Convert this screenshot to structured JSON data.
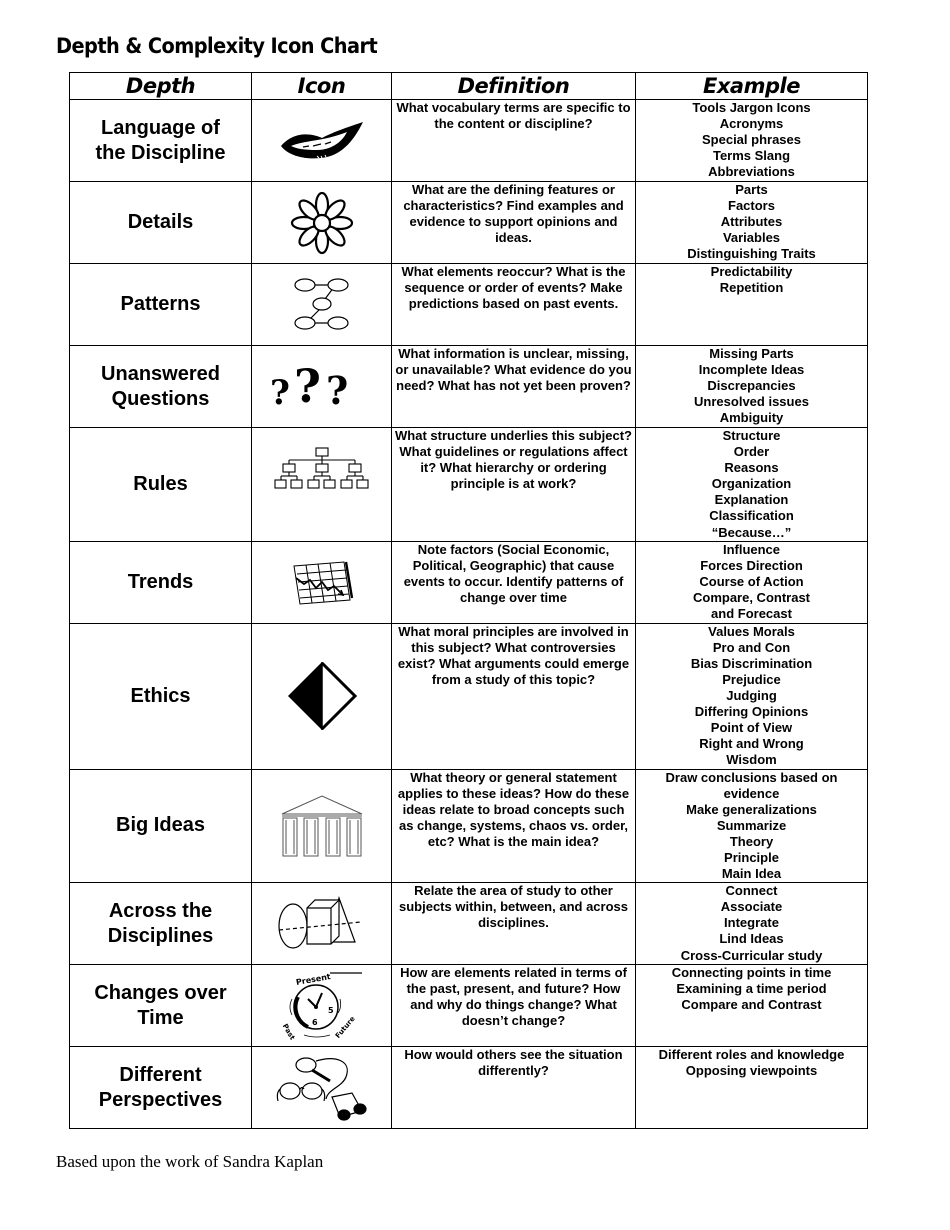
{
  "title": "Depth & Complexity Icon Chart",
  "headers": {
    "depth": "Depth",
    "icon": "Icon",
    "definition": "Definition",
    "example": "Example"
  },
  "rows": [
    {
      "depth": "Language of the Discipline",
      "icon": "lips-icon",
      "definition": "What vocabulary terms are specific to the content or discipline?",
      "examples": [
        "Tools Jargon Icons",
        "Acronyms",
        "Special phrases",
        "Terms Slang",
        "Abbreviations"
      ]
    },
    {
      "depth": "Details",
      "icon": "flower-icon",
      "definition": "What are the defining features or characteristics? Find examples and evidence to support opinions and ideas.",
      "examples": [
        "Parts",
        "Factors",
        "Attributes",
        "Variables",
        "Distinguishing Traits"
      ]
    },
    {
      "depth": "Patterns",
      "icon": "connected-circles-icon",
      "definition": "What elements reoccur? What is the sequence or order of events? Make predictions based on past events.",
      "examples": [
        "Predictability",
        "Repetition"
      ]
    },
    {
      "depth": "Unanswered Questions",
      "icon": "question-marks-icon",
      "definition": "What information is unclear, missing, or unavailable? What evidence do you need? What has not yet been proven?",
      "examples": [
        "Missing Parts",
        "Incomplete Ideas",
        "Discrepancies",
        "Unresolved issues",
        "Ambiguity"
      ]
    },
    {
      "depth": "Rules",
      "icon": "hierarchy-icon",
      "definition": "What structure underlies this subject? What guidelines or regulations affect it? What hierarchy or ordering principle is at work?",
      "examples": [
        "Structure",
        "Order",
        "Reasons",
        "Organization",
        "Explanation",
        "Classification",
        "“Because…”"
      ]
    },
    {
      "depth": "Trends",
      "icon": "trend-graph-icon",
      "definition": "Note factors (Social Economic, Political, Geographic) that cause events to occur. Identify patterns of change over time",
      "examples": [
        "Influence",
        "Forces Direction",
        "Course of Action",
        "Compare, Contrast",
        "and Forecast"
      ]
    },
    {
      "depth": "Ethics",
      "icon": "half-diamond-icon",
      "definition": "What moral principles are involved in this subject? What controversies exist? What arguments could emerge from a study of this topic?",
      "examples": [
        "Values Morals",
        "Pro and Con",
        "Bias Discrimination",
        "Prejudice",
        "Judging",
        "Differing Opinions",
        "Point of View",
        "Right and Wrong",
        "Wisdom"
      ]
    },
    {
      "depth": "Big Ideas",
      "icon": "temple-icon",
      "definition": "What theory or general statement applies to these ideas? How do these ideas relate to broad concepts such as change, systems, chaos vs. order, etc? What is the main idea?",
      "examples": [
        "Draw conclusions based on",
        "evidence",
        "Make generalizations",
        "Summarize",
        "Theory",
        "Principle",
        "Main Idea"
      ]
    },
    {
      "depth": "Across the Disciplines",
      "icon": "geometric-shapes-icon",
      "definition": "Relate the area of study to other subjects within, between, and across disciplines.",
      "examples": [
        "Connect",
        "Associate",
        "Integrate",
        "Lind Ideas",
        "Cross-Curricular study"
      ]
    },
    {
      "depth": "Changes over Time",
      "icon": "clock-icon",
      "definition": "How are elements related in terms of the past, present, and future? How and why do things change? What doesn’t change?",
      "examples": [
        "Connecting points in time",
        "Examining a time period",
        "Compare and Contrast"
      ]
    },
    {
      "depth": "Different Perspectives",
      "icon": "glasses-binoculars-icon",
      "definition": "How would others see the situation differently?",
      "examples": [
        "Different roles and knowledge",
        "Opposing viewpoints"
      ]
    }
  ],
  "clock_labels": {
    "present": "Present",
    "past": "Past",
    "future": "Future"
  },
  "footer": "Based upon the work of Sandra Kaplan"
}
